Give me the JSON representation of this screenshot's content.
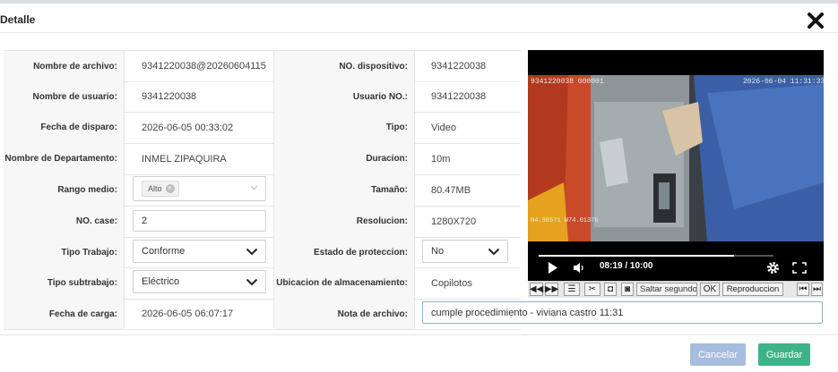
{
  "dialog": {
    "title": "Detalle"
  },
  "left_rows": [
    {
      "label": "Nombre de archivo:",
      "value": "9341220038@20260604115"
    },
    {
      "label": "Nombre de usuario:",
      "value": "9341220038"
    },
    {
      "label": "Fecha de disparo:",
      "value": "2026-06-05 00:33:02"
    },
    {
      "label": "Nombre de Departamento:",
      "value": "INMEL ZIPAQUIRA"
    },
    {
      "label": "Rango medio:",
      "tag": "Alto"
    },
    {
      "label": "NO. case:",
      "input": "2"
    },
    {
      "label": "Tipo Trabajo:",
      "select": "Conforme"
    },
    {
      "label": "Tipo subtrabajo:",
      "select": "Eléctrico"
    },
    {
      "label": "Fecha de carga:",
      "value": "2026-06-05 06:07:17"
    }
  ],
  "right_rows": [
    {
      "label": "NO. dispositivo:",
      "value": "9341220038"
    },
    {
      "label": "Usuario NO.:",
      "value": "9341220038"
    },
    {
      "label": "Tipo:",
      "value": "Video"
    },
    {
      "label": "Duracion:",
      "value": "10m"
    },
    {
      "label": "Tamaño:",
      "value": "80.47MB"
    },
    {
      "label": "Resolucion:",
      "value": "1280X720"
    },
    {
      "label": "Estado de proteccion:",
      "select": "No"
    },
    {
      "label": "Ubicacion de almacenamiento:",
      "value": "Copilotos"
    },
    {
      "label": "Nota de archivo:",
      "input": "cumple procedimiento - viviana castro  11:31"
    }
  ],
  "video": {
    "overlay_left": "9341220038 000001",
    "overlay_right": "2026-06-04 11:31:33",
    "overlay_bottom": "N4.90571 W74.01376",
    "time": "08:19 / 10:00",
    "progress": 0.832,
    "jump_placeholder": "Saltar segundo",
    "ok_label": "OK",
    "play_label": "Reproduccion"
  },
  "footer": {
    "cancel_label": "Cancelar",
    "save_label": "Guardar"
  },
  "colors": {
    "cancel": "#a7bde0",
    "save": "#3eb389"
  }
}
